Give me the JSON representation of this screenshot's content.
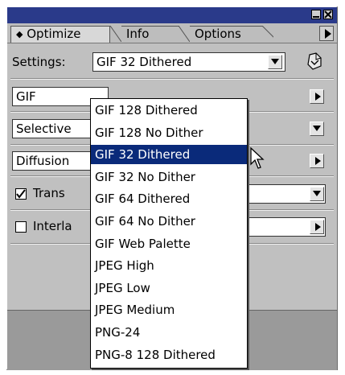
{
  "tabs": [
    {
      "label": "Optimize",
      "icon": "up-down-arrows-icon"
    },
    {
      "label": "Info"
    },
    {
      "label": "Options"
    }
  ],
  "settings": {
    "label": "Settings:",
    "selected": "GIF 32 Dithered"
  },
  "rows": {
    "format": "GIF",
    "palette": "Selective",
    "dither": "Diffusion",
    "transparency": {
      "label": "Trans",
      "checked": true
    },
    "interlaced": {
      "label": "Interla",
      "checked": false
    }
  },
  "menu": {
    "items": [
      "GIF 128 Dithered",
      "GIF 128 No Dither",
      "GIF 32 Dithered",
      "GIF 32 No Dither",
      "GIF 64 Dithered",
      "GIF 64 No Dither",
      "GIF Web Palette",
      "JPEG High",
      "JPEG Low",
      "JPEG Medium",
      "PNG-24",
      "PNG-8 128 Dithered"
    ],
    "selected_index": 2
  },
  "colors": {
    "titlebar": "#2a3a8a",
    "selection": "#0a2a7a"
  }
}
